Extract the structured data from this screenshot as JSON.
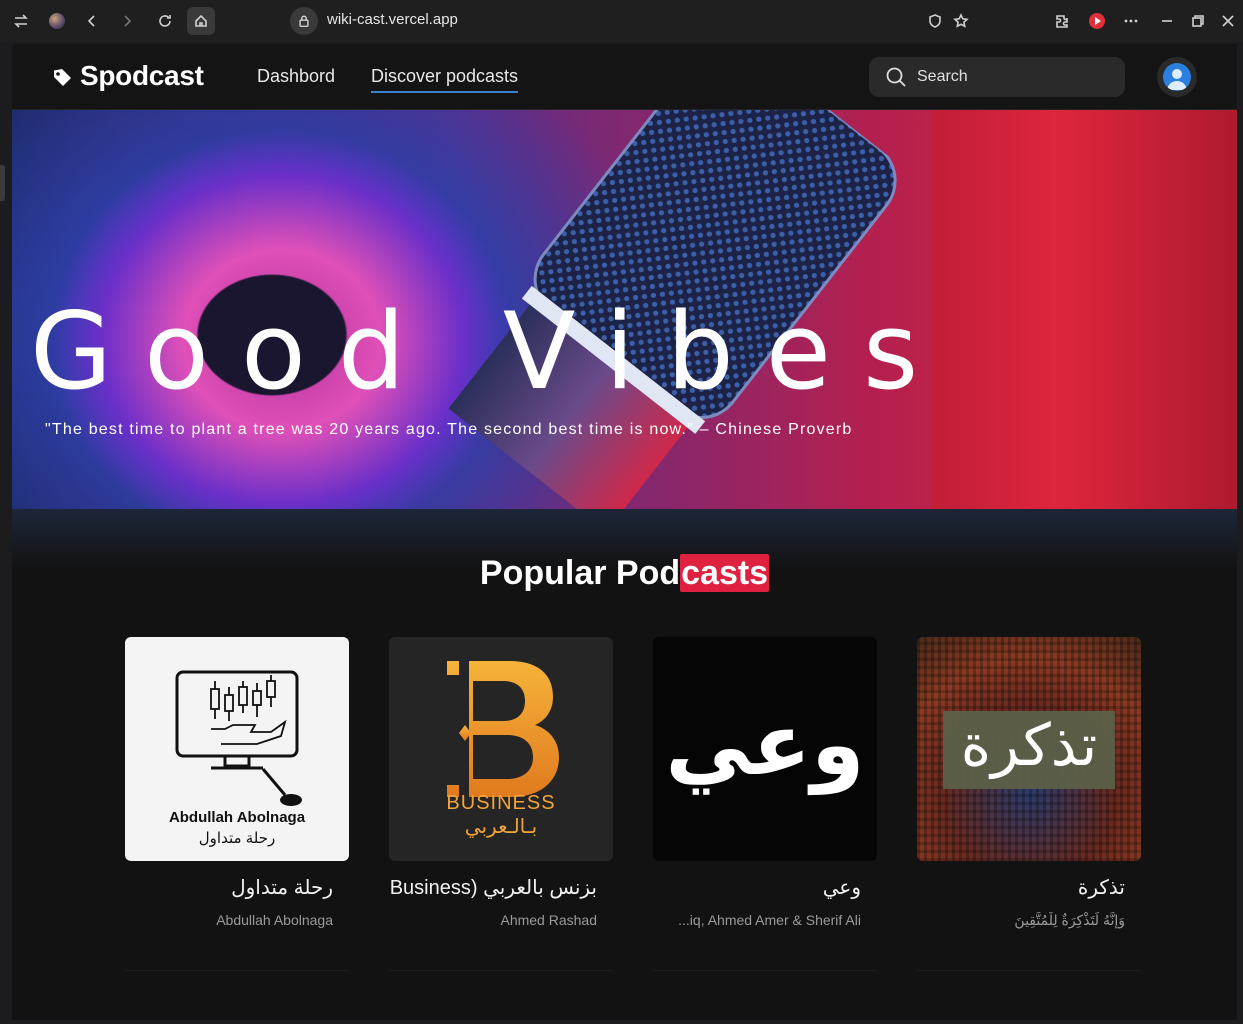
{
  "browser": {
    "url": "wiki-cast.vercel.app"
  },
  "site": {
    "brand": "Spodcast",
    "nav": [
      {
        "label": "Dashbord"
      },
      {
        "label": "Discover podcasts"
      }
    ],
    "search_placeholder": "Search"
  },
  "hero": {
    "title": "Good Vibes",
    "quote": "\"The best time to plant a tree was 20 years ago. The second best time is now.\" – Chinese Proverb"
  },
  "section": {
    "title_part1": "Popular Pod",
    "title_part2": "casts"
  },
  "podcasts": [
    {
      "name": "رحلة متداول",
      "author": "Abdullah Abolnaga",
      "cover_line1": "Abdullah Abolnaga",
      "cover_line2": "رحلة متداول"
    },
    {
      "name": "بزنس بالعربي (Business...",
      "author": "Ahmed Rashad",
      "cover_line1": "BUSINESS",
      "cover_line2": "بـالـعربي"
    },
    {
      "name": "وعي",
      "author": "...iq, Ahmed Amer & Sherif Ali",
      "cover_line1": "وعي"
    },
    {
      "name": "تذكرة",
      "author": "وَإِنَّهُ لَتَذْكِرَةٌ لِلْمُتَّقِينَ",
      "cover_line1": "تذكرة"
    }
  ],
  "colors": {
    "accent": "#e0203f",
    "nav_underline": "#3d7fd0",
    "background": "#121212"
  }
}
